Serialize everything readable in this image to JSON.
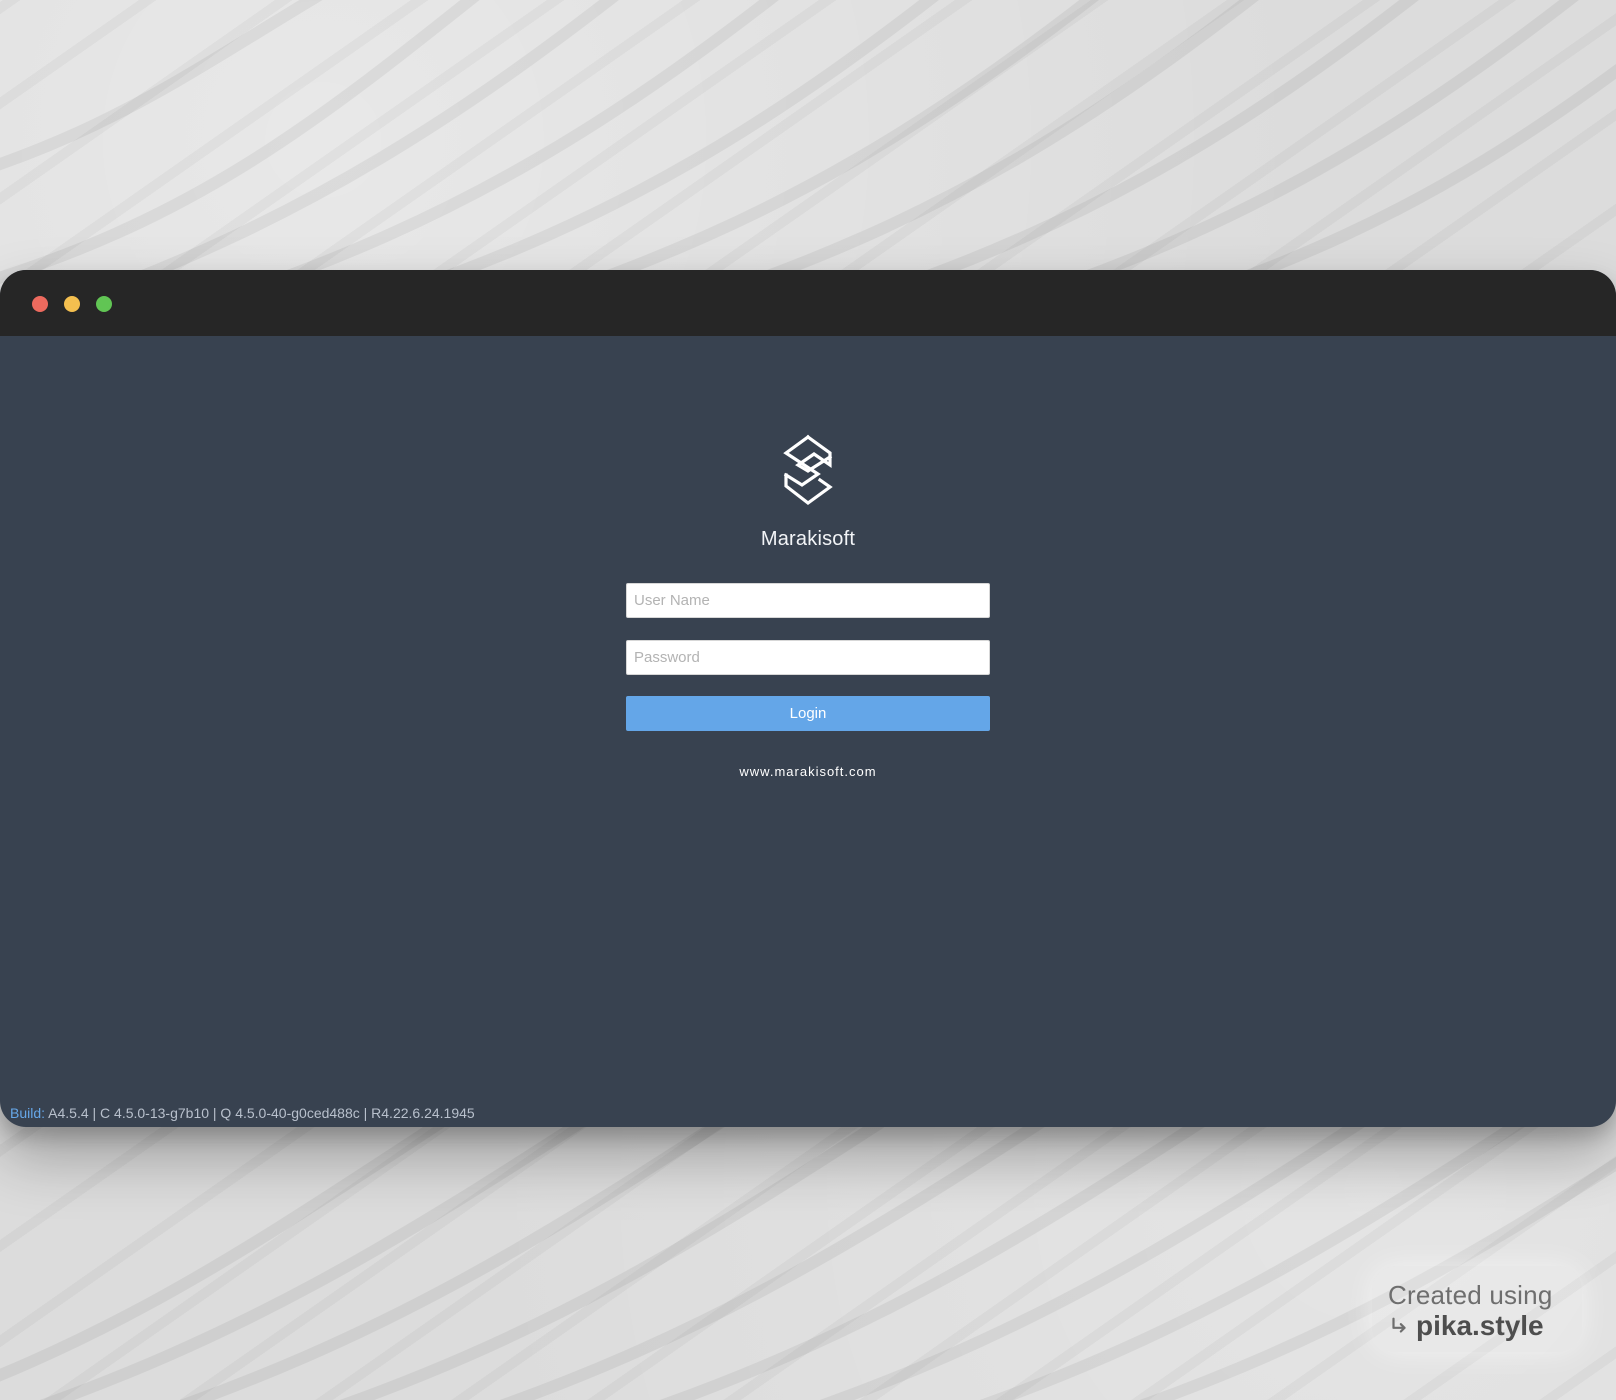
{
  "colors": {
    "window_background": "#384250",
    "titlebar": "#262626",
    "traffic_red": "#ed6a5e",
    "traffic_yellow": "#f4bf4f",
    "traffic_green": "#61c554",
    "login_button": "#64a6e8",
    "build_label": "#66a7e8"
  },
  "window": {
    "traffic_lights": [
      {
        "name": "close",
        "icon": "close-traffic-light"
      },
      {
        "name": "minimize",
        "icon": "minimize-traffic-light"
      },
      {
        "name": "zoom",
        "icon": "zoom-traffic-light"
      }
    ]
  },
  "login": {
    "logo_icon": "marakisoft-logo",
    "app_name": "Marakisoft",
    "username_placeholder": "User Name",
    "password_placeholder": "Password",
    "login_label": "Login",
    "website": "www.marakisoft.com"
  },
  "footer": {
    "build_label": "Build:",
    "build_value": "A4.5.4 | C 4.5.0-13-g7b10 | Q 4.5.0-40-g0ced488c | R4.22.6.24.1945"
  },
  "watermark": {
    "line1": "Created using",
    "line2": "pika.style",
    "icon": "return-arrow-icon"
  }
}
